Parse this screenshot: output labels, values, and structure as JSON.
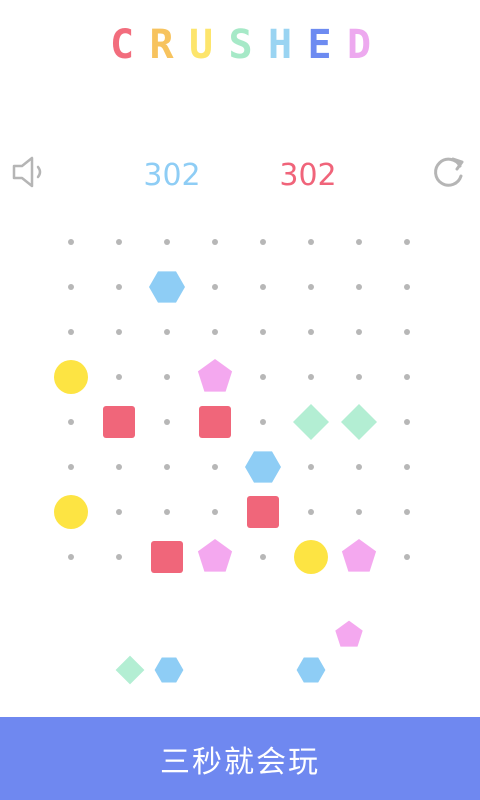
{
  "app": {
    "logo_text": "CRUSHED",
    "logo_colors": [
      "#f26d7d",
      "#f7c35e",
      "#fde56c",
      "#a6e9c7",
      "#9ad4f2",
      "#6d8bf1",
      "#eda9ef"
    ]
  },
  "hud": {
    "sound_icon": "speaker-icon",
    "restart_icon": "restart-icon",
    "score_left": "302",
    "score_right": "302",
    "score_left_color": "#8ecdf5",
    "score_right_color": "#f0647a",
    "icon_color": "#b5b5b5"
  },
  "board": {
    "columns": 8,
    "rows": 8,
    "dot_color": "#b7b7b7",
    "piece_colors": {
      "hexagon": "#8ecdf5",
      "circle": "#fde443",
      "pentagon": "#f4a8ef",
      "square": "#f0667a",
      "diamond": "#b3eed3"
    },
    "pieces": [
      {
        "type": "hexagon",
        "col": 2,
        "row": 1
      },
      {
        "type": "circle",
        "col": 0,
        "row": 3
      },
      {
        "type": "pentagon",
        "col": 3,
        "row": 3
      },
      {
        "type": "square",
        "col": 1,
        "row": 4
      },
      {
        "type": "square",
        "col": 3,
        "row": 4
      },
      {
        "type": "diamond",
        "col": 5,
        "row": 4
      },
      {
        "type": "diamond",
        "col": 6,
        "row": 4
      },
      {
        "type": "hexagon",
        "col": 4,
        "row": 5
      },
      {
        "type": "circle",
        "col": 0,
        "row": 6
      },
      {
        "type": "square",
        "col": 4,
        "row": 6
      },
      {
        "type": "square",
        "col": 2,
        "row": 7
      },
      {
        "type": "pentagon",
        "col": 3,
        "row": 7
      },
      {
        "type": "circle",
        "col": 5,
        "row": 7
      },
      {
        "type": "pentagon",
        "col": 6,
        "row": 7
      }
    ]
  },
  "queue": {
    "items": [
      {
        "type": "diamond",
        "slot": "left-1"
      },
      {
        "type": "hexagon",
        "slot": "left-2"
      },
      {
        "type": "hexagon",
        "slot": "right-1"
      },
      {
        "type": "pentagon",
        "slot": "right-2"
      }
    ]
  },
  "footer": {
    "label": "三秒就会玩",
    "background": "#6f88f0"
  }
}
